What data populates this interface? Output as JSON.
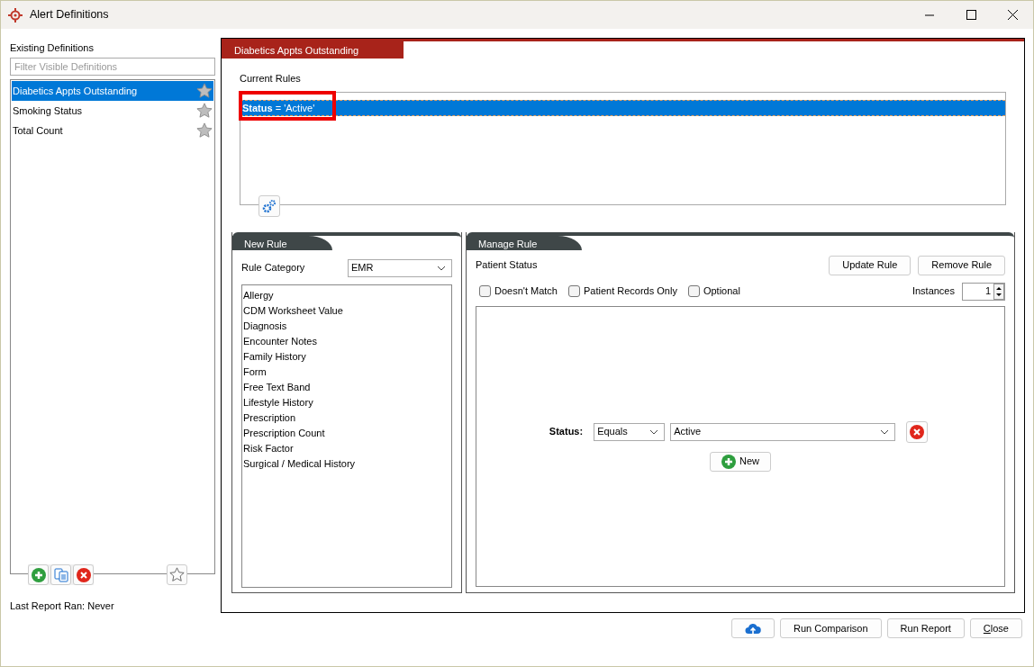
{
  "window": {
    "title": "Alert Definitions"
  },
  "definitions": {
    "label": "Existing Definitions",
    "filter_placeholder": "Filter Visible Definitions",
    "items": [
      {
        "name": "Diabetics Appts Outstanding",
        "selected": true
      },
      {
        "name": "Smoking Status",
        "selected": false
      },
      {
        "name": "Total Count",
        "selected": false
      }
    ]
  },
  "last_report": "Last Report Ran: Never",
  "definition": {
    "title": "Diabetics Appts Outstanding",
    "rules_label": "Current Rules",
    "rules": [
      {
        "text": "**Status** = 'Active'",
        "selected": true,
        "highlighted": true
      }
    ]
  },
  "new_rule": {
    "title": "New Rule",
    "category_label": "Rule Category",
    "category": "EMR",
    "categories": [
      "Allergy",
      "CDM Worksheet Value",
      "Diagnosis",
      "Encounter Notes",
      "Family History",
      "Form",
      "Free Text Band",
      "Lifestyle History",
      "Prescription",
      "Prescription Count",
      "Risk Factor",
      "Surgical / Medical History"
    ]
  },
  "manage_rule": {
    "title": "Manage Rule",
    "rule_name": "Patient Status",
    "buttons": [
      "Update Rule",
      "Remove Rule"
    ],
    "options": [
      {
        "label": "Doesn't Match",
        "checked": false
      },
      {
        "label": "Patient Records Only",
        "checked": false
      },
      {
        "label": "Optional",
        "checked": false
      }
    ],
    "instances_label": "Instances",
    "instances": "1",
    "conditions": [
      {
        "field": "Status:",
        "operator": "Equals",
        "value": "Active"
      }
    ],
    "new_button": "New"
  },
  "footer_buttons": [
    {
      "label": "Run Comparison",
      "mnemonic": false
    },
    {
      "label": "Run Report",
      "mnemonic": false
    },
    {
      "label": "Close",
      "mnemonic": true
    }
  ]
}
